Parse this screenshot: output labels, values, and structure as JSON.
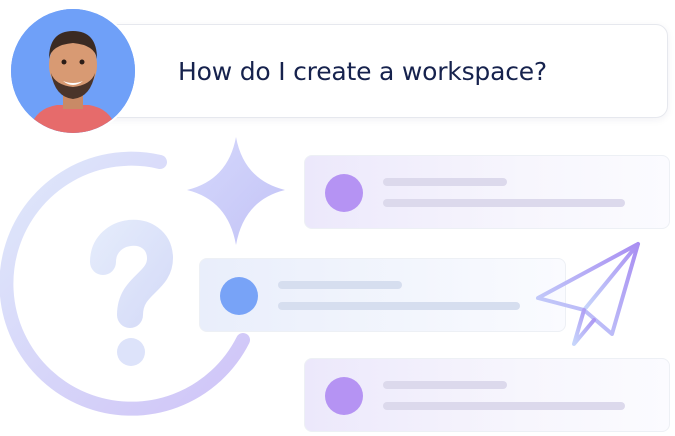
{
  "question": {
    "text": "How do I create a workspace?"
  },
  "avatar": {
    "icon": "person-avatar"
  },
  "decorations": {
    "icons": [
      "question-mark-icon",
      "sparkle-icon",
      "paper-plane-icon",
      "progress-arc"
    ]
  },
  "results": [
    {
      "dot_color": "#b593f3"
    },
    {
      "dot_color": "#78a3f7"
    },
    {
      "dot_color": "#b593f3"
    }
  ],
  "colors": {
    "text": "#16224d",
    "purple_accent": "#b593f3",
    "blue_accent": "#78a3f7",
    "avatar_bg": "#6fa0f8"
  }
}
